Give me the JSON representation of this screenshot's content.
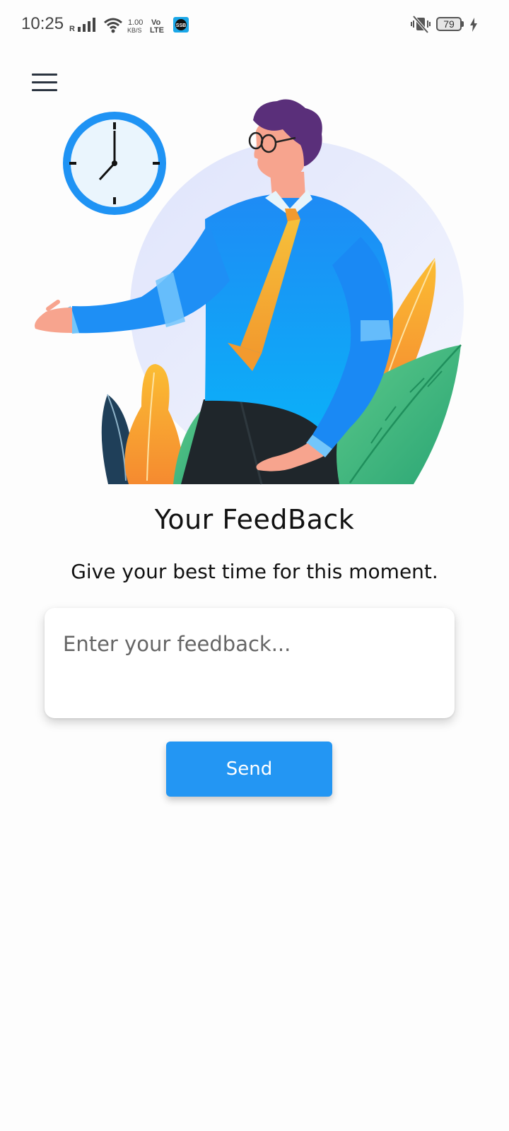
{
  "status_bar": {
    "time": "10:25",
    "signal_prefix": "R",
    "net_speed_value": "1.00",
    "net_speed_unit": "KB/S",
    "volte_top": "Vo",
    "volte_bottom": "LTE",
    "app_badge": "SSB",
    "battery_level": "79",
    "icons": [
      "signal-icon",
      "wifi-icon",
      "volte-icon",
      "app-notification-icon",
      "vibrate-icon",
      "battery-icon",
      "charging-icon"
    ]
  },
  "header": {
    "menu_icon": "hamburger-menu-icon"
  },
  "hero": {
    "illustration": "man-with-clock-illustration"
  },
  "feedback": {
    "title": "Your FeedBack",
    "subtitle": "Give your best time for this moment.",
    "input_value": "",
    "input_placeholder": "Enter your feedback...",
    "send_label": "Send"
  },
  "colors": {
    "accent": "#2396f3",
    "background": "#fdfdfd",
    "card": "#ffffff",
    "text": "#111111"
  }
}
